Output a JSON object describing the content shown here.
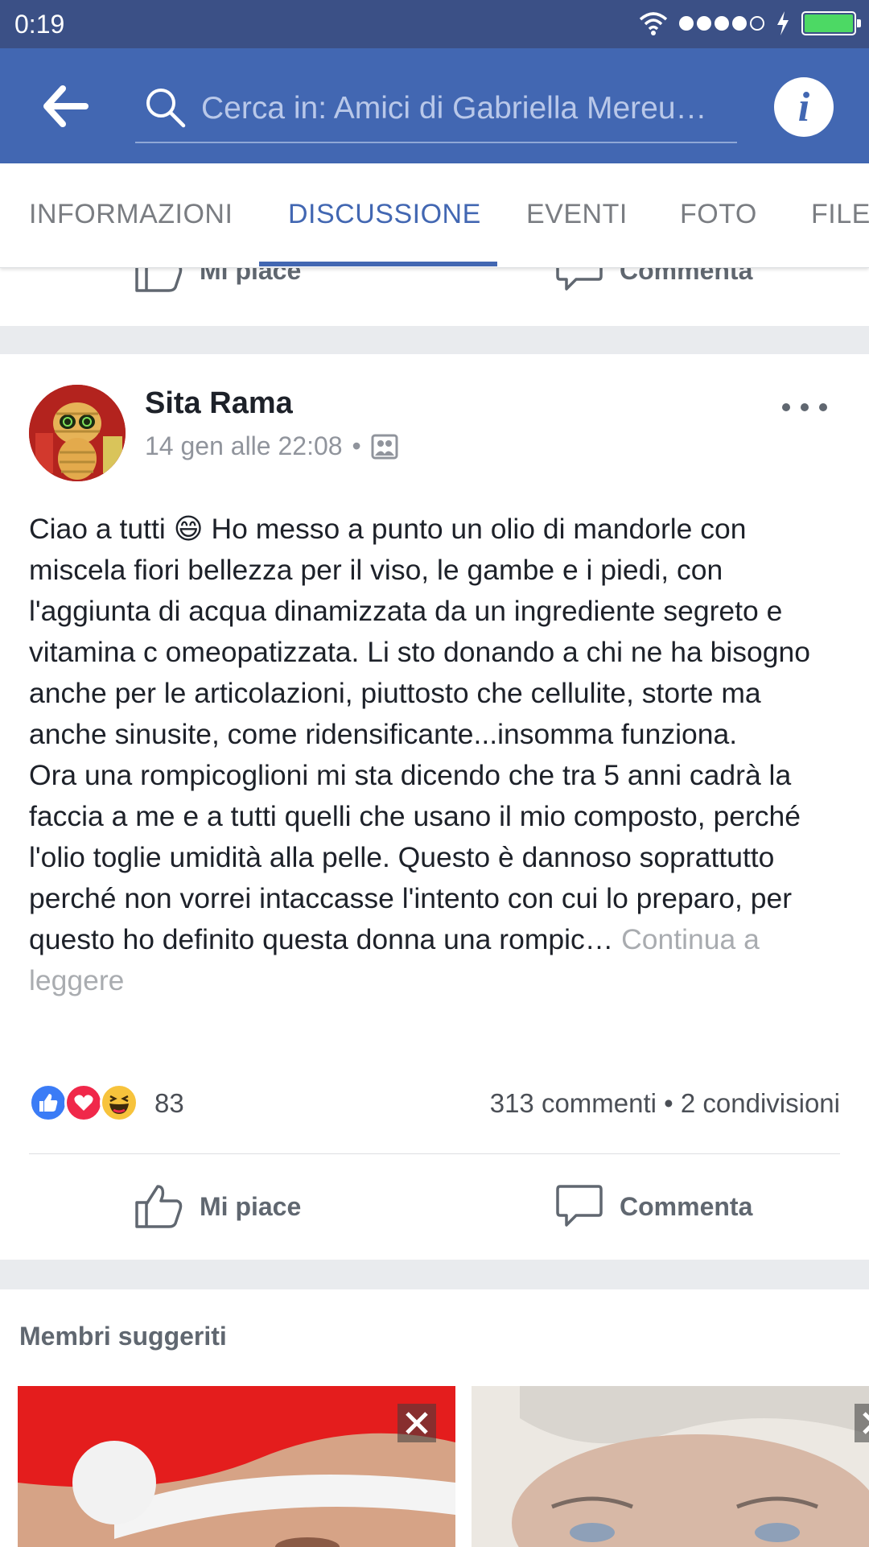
{
  "status_bar": {
    "time": "0:19"
  },
  "header": {
    "search_placeholder": "Cerca in: Amici di Gabriella Mereu…"
  },
  "tabs": [
    {
      "label": "INFORMAZIONI",
      "active": false
    },
    {
      "label": "DISCUSSIONE",
      "active": true
    },
    {
      "label": "EVENTI",
      "active": false
    },
    {
      "label": "FOTO",
      "active": false
    },
    {
      "label": "FILE",
      "active": false
    }
  ],
  "previous_post_actions": {
    "like_label": "Mi piace",
    "comment_label": "Commenta"
  },
  "post": {
    "author": "Sita Rama",
    "timestamp": "14 gen alle 22:08",
    "separator": "•",
    "body_before_emoji": "Ciao a tutti ",
    "emoji": "😄",
    "body_after_emoji": " Ho messo a punto un olio di mandorle con miscela fiori bellezza per il viso, le gambe e i piedi, con l'aggiunta di acqua dinamizzata da un ingrediente segreto e vitamina c omeopatizzata. Li sto donando a chi ne ha bisogno anche per le articolazioni, piuttosto che cellulite, storte ma anche sinusite, come ridensificante...insomma funziona.\nOra una rompicoglioni mi sta dicendo che tra 5 anni cadrà la faccia a me e a tutti quelli che usano il mio composto, perché l'olio toglie umidità alla pelle. Questo è dannoso soprattutto perché non vorrei intaccasse l'intento con cui lo preparo, per questo ho definito questa donna una rompic… ",
    "continue_label": "Continua a leggere",
    "reaction_count": "83",
    "comments": "313 commenti",
    "shares": "• 2 condivisioni",
    "like_label": "Mi piace",
    "comment_label": "Commenta"
  },
  "suggested": {
    "title": "Membri suggeriti"
  },
  "colors": {
    "facebook_blue": "#4267b2",
    "status_bar": "#3b5086",
    "divider": "#e9ebee"
  }
}
